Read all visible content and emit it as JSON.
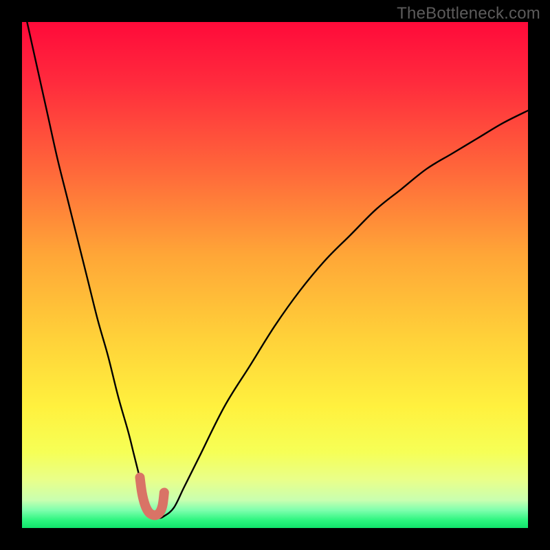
{
  "watermark": "TheBottleneck.com",
  "colors": {
    "gradient_stops": [
      {
        "offset": 0.0,
        "color": "#ff0a3a"
      },
      {
        "offset": 0.12,
        "color": "#ff2b3d"
      },
      {
        "offset": 0.3,
        "color": "#ff6a3a"
      },
      {
        "offset": 0.46,
        "color": "#ffa637"
      },
      {
        "offset": 0.62,
        "color": "#ffd039"
      },
      {
        "offset": 0.76,
        "color": "#fff13e"
      },
      {
        "offset": 0.85,
        "color": "#f6ff56"
      },
      {
        "offset": 0.905,
        "color": "#e9ff8a"
      },
      {
        "offset": 0.945,
        "color": "#c9ffb0"
      },
      {
        "offset": 0.965,
        "color": "#7dffad"
      },
      {
        "offset": 0.985,
        "color": "#2bf57e"
      },
      {
        "offset": 1.0,
        "color": "#11e36b"
      }
    ],
    "curve": "#000000",
    "highlight_fill": "#d97366",
    "highlight_stroke": "#c55a4c"
  },
  "chart_data": {
    "type": "line",
    "title": "",
    "xlabel": "",
    "ylabel": "",
    "xlim": [
      0,
      100
    ],
    "ylim": [
      0,
      100
    ],
    "series": [
      {
        "name": "bottleneck-curve",
        "x": [
          1,
          3,
          5,
          7,
          9,
          11,
          13,
          15,
          17,
          19,
          21,
          22,
          23,
          24,
          25,
          26,
          27,
          28,
          30,
          32,
          35,
          40,
          45,
          50,
          55,
          60,
          65,
          70,
          75,
          80,
          85,
          90,
          95,
          100
        ],
        "y": [
          100,
          91,
          82,
          73,
          65,
          57,
          49,
          41,
          34,
          26,
          19,
          15,
          11,
          7,
          4,
          2.5,
          2,
          2.3,
          4,
          8,
          14,
          24,
          32,
          40,
          47,
          53,
          58,
          63,
          67,
          71,
          74,
          77,
          80,
          82.5
        ]
      }
    ],
    "highlight": {
      "name": "optimal-range",
      "x": [
        23.3,
        23.7,
        24.3,
        25.0,
        25.8,
        26.6,
        27.3,
        27.8,
        28.1
      ],
      "y": [
        10.0,
        7.0,
        4.6,
        3.2,
        2.6,
        2.6,
        3.2,
        4.6,
        7.0
      ]
    }
  }
}
